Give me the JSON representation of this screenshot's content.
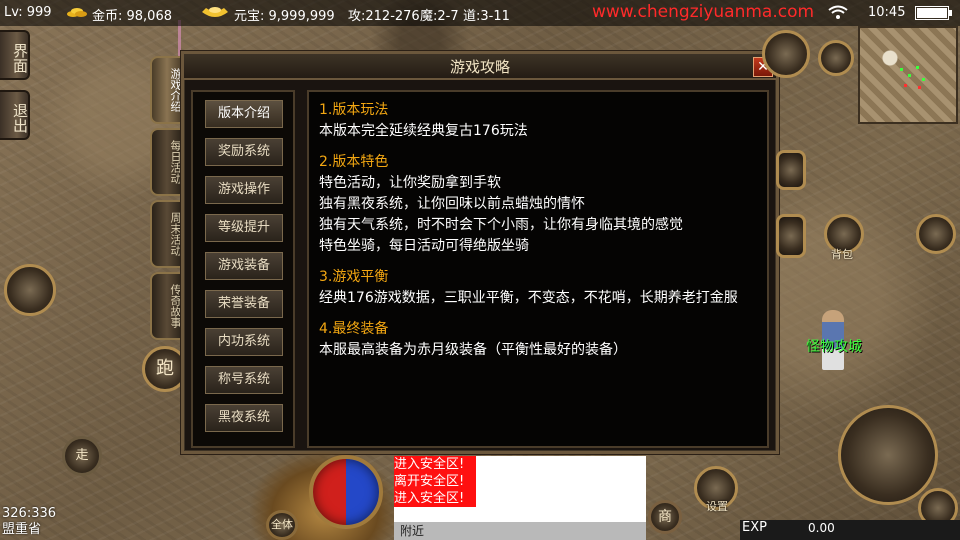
{
  "topbar": {
    "level": "Lv: 999",
    "gold_label": "金币: 98,068",
    "ingot_label": "元宝: 9,999,999",
    "attack": "攻:212-276",
    "magic": "魔:2-7",
    "tao": "道:3-11",
    "url": "www.chengziyuanma.com",
    "time": "10:45"
  },
  "side_buttons": [
    {
      "label": "界面",
      "icon": "interface"
    },
    {
      "label": "退出",
      "icon": "exit"
    }
  ],
  "dialog": {
    "title": "游戏攻略",
    "close_label": "✕",
    "vertical_tabs": [
      "游戏介绍",
      "每日活动",
      "周末活动",
      "传奇故事"
    ],
    "active_tab": "游戏介绍",
    "menu": [
      "版本介绍",
      "奖励系统",
      "游戏操作",
      "等级提升",
      "游戏装备",
      "荣誉装备",
      "内功系统",
      "称号系统",
      "黑夜系统"
    ],
    "active_menu": "版本介绍",
    "sections": [
      {
        "title": "1.版本玩法",
        "lines": [
          "本版本完全延续经典复古176玩法"
        ]
      },
      {
        "title": "2.版本特色",
        "lines": [
          "特色活动，让你奖励拿到手软",
          "独有黑夜系统，让你回味以前点蜡烛的情怀",
          "独有天气系统，时不时会下个小雨，让你有身临其境的感觉",
          "特色坐骑，每日活动可得绝版坐骑"
        ]
      },
      {
        "title": "3.游戏平衡",
        "lines": [
          "经典176游戏数据，三职业平衡，不变态，不花哨，长期养老打金服"
        ]
      },
      {
        "title": "4.最终装备",
        "lines": [
          "本服最高装备为赤月级装备（平衡性最好的装备）"
        ]
      }
    ]
  },
  "buttons": {
    "run": "跑",
    "walk": "走",
    "shop": "商",
    "all": "全体",
    "settings": "设置",
    "bag": "背包"
  },
  "npc_label": "怪物攻城",
  "chat": {
    "lines": [
      "进入安全区!",
      "离开安全区!",
      "进入安全区!"
    ],
    "tab": "附近"
  },
  "coords": {
    "position": "326:336",
    "map": "盟重省"
  },
  "exp": {
    "label": "EXP",
    "value": "0.00"
  },
  "colors": {
    "accent": "#f3a712",
    "url": "#ff2a2a",
    "npc": "#3cff3c",
    "chat_bg": "#ff1010"
  }
}
